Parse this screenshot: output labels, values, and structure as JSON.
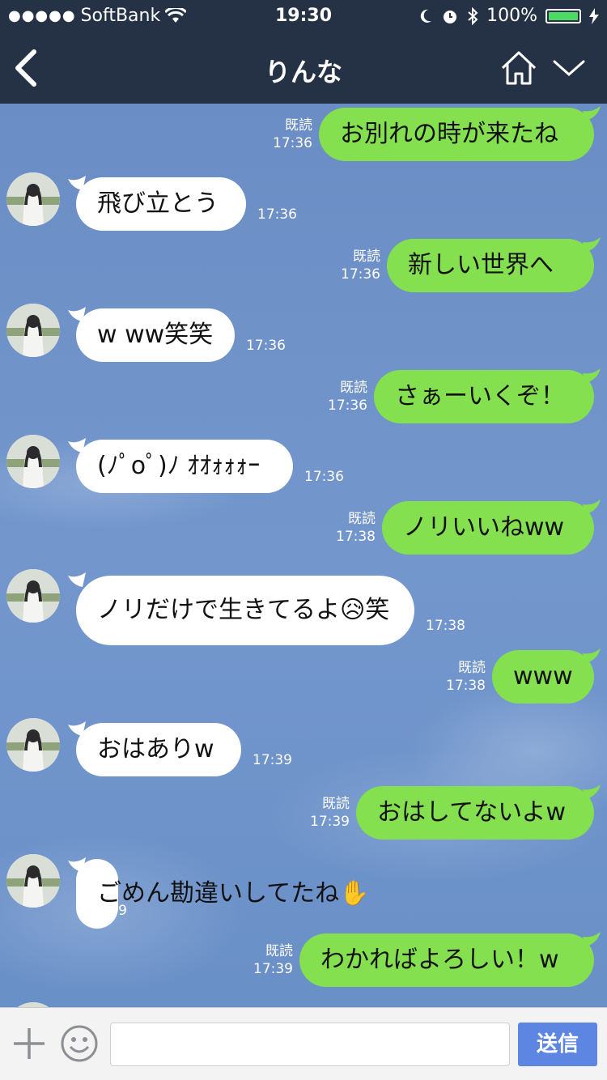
{
  "status_bar": {
    "carrier": "SoftBank",
    "time": "19:30",
    "battery": "100%",
    "battery_level": 1.0,
    "icons": [
      "signal-dots-icon",
      "wifi-icon",
      "moon-icon",
      "alarm-icon",
      "bluetooth-icon",
      "battery-icon",
      "charging-icon"
    ]
  },
  "header": {
    "title": "りんな",
    "icons": [
      "back-chevron-icon",
      "home-icon",
      "chevron-down-icon"
    ]
  },
  "messages": [
    {
      "dir": "out",
      "text": "お別れの時が来たね",
      "read": "既読",
      "time": "17:36"
    },
    {
      "dir": "in",
      "text": "飛び立とう",
      "time": "17:36"
    },
    {
      "dir": "out",
      "text": "新しい世界へ",
      "read": "既読",
      "time": "17:36"
    },
    {
      "dir": "in",
      "text": "w ww笑笑",
      "time": "17:36"
    },
    {
      "dir": "out",
      "text": "さぁーいくぞ！",
      "read": "既読",
      "time": "17:36"
    },
    {
      "dir": "in",
      "text": "(ﾉﾟοﾟ)ﾉ ｵｵｫｫｫｰ",
      "time": "17:36"
    },
    {
      "dir": "out",
      "text": "ノリいいねww",
      "read": "既読",
      "time": "17:38"
    },
    {
      "dir": "in",
      "text": "ノリだけで生きてるよ😥笑",
      "time": "17:38"
    },
    {
      "dir": "out",
      "text": "www",
      "read": "既読",
      "time": "17:38"
    },
    {
      "dir": "in",
      "text": "おはありw",
      "time": "17:39"
    },
    {
      "dir": "out",
      "text": "おはしてないよw",
      "read": "既読",
      "time": "17:39"
    },
    {
      "dir": "in",
      "text": "ごめん勘違いしてたね✋",
      "time": "17:39"
    },
    {
      "dir": "out",
      "text": "わかればよろしい！w",
      "read": "既読",
      "time": "17:39"
    }
  ],
  "input_bar": {
    "value": "",
    "send_label": "送信",
    "icons": [
      "plus-icon",
      "emoji-icon"
    ]
  },
  "colors": {
    "header_bg": "#253246",
    "outgoing_bubble": "#84e04f",
    "incoming_bubble": "#ffffff",
    "send_button": "#5d86e3"
  }
}
